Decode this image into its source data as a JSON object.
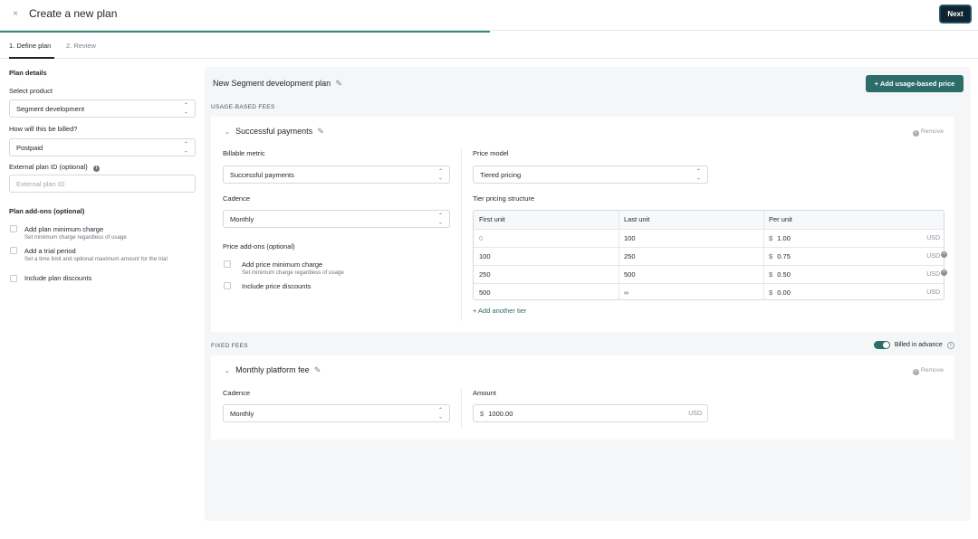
{
  "header": {
    "close_icon": "×",
    "title": "Create a new plan",
    "next_label": "Next",
    "progress_fraction": 0.5
  },
  "tabs": [
    {
      "label": "1. Define plan",
      "active": true
    },
    {
      "label": "2. Review",
      "active": false
    }
  ],
  "left": {
    "plan_details_label": "Plan details",
    "select_product_label": "Select product",
    "select_product_value": "Segment development",
    "billing_label": "How will this be billed?",
    "billing_value": "Postpaid",
    "external_id_label": "External plan ID (optional)",
    "external_id_placeholder": "External plan ID",
    "addons_label": "Plan add-ons (optional)",
    "addons": [
      {
        "title": "Add plan minimum charge",
        "subtitle": "Set minimum charge regardless of usage"
      },
      {
        "title": "Add a trial period",
        "subtitle": "Set a time limit and optional maximum amount for the trial"
      },
      {
        "title": "Include plan discounts",
        "subtitle": ""
      }
    ]
  },
  "main": {
    "plan_name": "New Segment development plan",
    "add_usage_price_label": "+ Add usage-based price",
    "usage_fees_label": "USAGE-BASED FEES",
    "usage_fee": {
      "name": "Successful payments",
      "remove_label": "Remove",
      "billable_metric_label": "Billable metric",
      "billable_metric_value": "Successful payments",
      "cadence_label": "Cadence",
      "cadence_value": "Monthly",
      "price_addons_label": "Price add-ons (optional)",
      "price_addons": [
        {
          "title": "Add price minimum charge",
          "subtitle": "Set minimum charge regardless of usage"
        },
        {
          "title": "Include price discounts",
          "subtitle": ""
        }
      ],
      "price_model_label": "Price model",
      "price_model_value": "Tiered pricing",
      "tier_structure_label": "Tier pricing structure",
      "tier_headers": [
        "First unit",
        "Last unit",
        "Per unit"
      ],
      "tiers": [
        {
          "first": "0",
          "last": "100",
          "currency_symbol": "$",
          "per_unit": "1.00",
          "currency": "USD",
          "removable": false
        },
        {
          "first": "100",
          "last": "250",
          "currency_symbol": "$",
          "per_unit": "0.75",
          "currency": "USD",
          "removable": true
        },
        {
          "first": "250",
          "last": "500",
          "currency_symbol": "$",
          "per_unit": "0.50",
          "currency": "USD",
          "removable": true
        },
        {
          "first": "500",
          "last": "∞",
          "currency_symbol": "$",
          "per_unit": "0.00",
          "currency": "USD",
          "removable": false
        }
      ],
      "add_tier_label": "+ Add another tier"
    },
    "fixed_fees_label": "FIXED FEES",
    "billed_in_advance_label": "Billed in advance",
    "billed_in_advance_on": true,
    "fixed_fee": {
      "name": "Monthly platform fee",
      "remove_label": "Remove",
      "cadence_label": "Cadence",
      "cadence_value": "Monthly",
      "amount_label": "Amount",
      "amount_currency_symbol": "$",
      "amount_value": "1000.00",
      "amount_currency": "USD"
    }
  }
}
